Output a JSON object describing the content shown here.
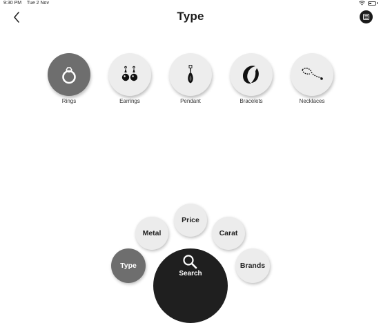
{
  "status": {
    "time": "9:30 PM",
    "date": "Tue 2 Nov"
  },
  "header": {
    "title": "Type"
  },
  "types": [
    {
      "label": "Rings",
      "icon": "ring-icon",
      "selected": true
    },
    {
      "label": "Earrings",
      "icon": "earrings-icon",
      "selected": false
    },
    {
      "label": "Pendant",
      "icon": "pendant-icon",
      "selected": false
    },
    {
      "label": "Bracelets",
      "icon": "bracelet-icon",
      "selected": false
    },
    {
      "label": "Necklaces",
      "icon": "necklace-icon",
      "selected": false
    }
  ],
  "filters": {
    "type": "Type",
    "metal": "Metal",
    "price": "Price",
    "carat": "Carat",
    "brands": "Brands",
    "search": "Search"
  },
  "colors": {
    "selected": "#6e6e6e",
    "unselected": "#ededed",
    "dark": "#1f1f1f"
  }
}
